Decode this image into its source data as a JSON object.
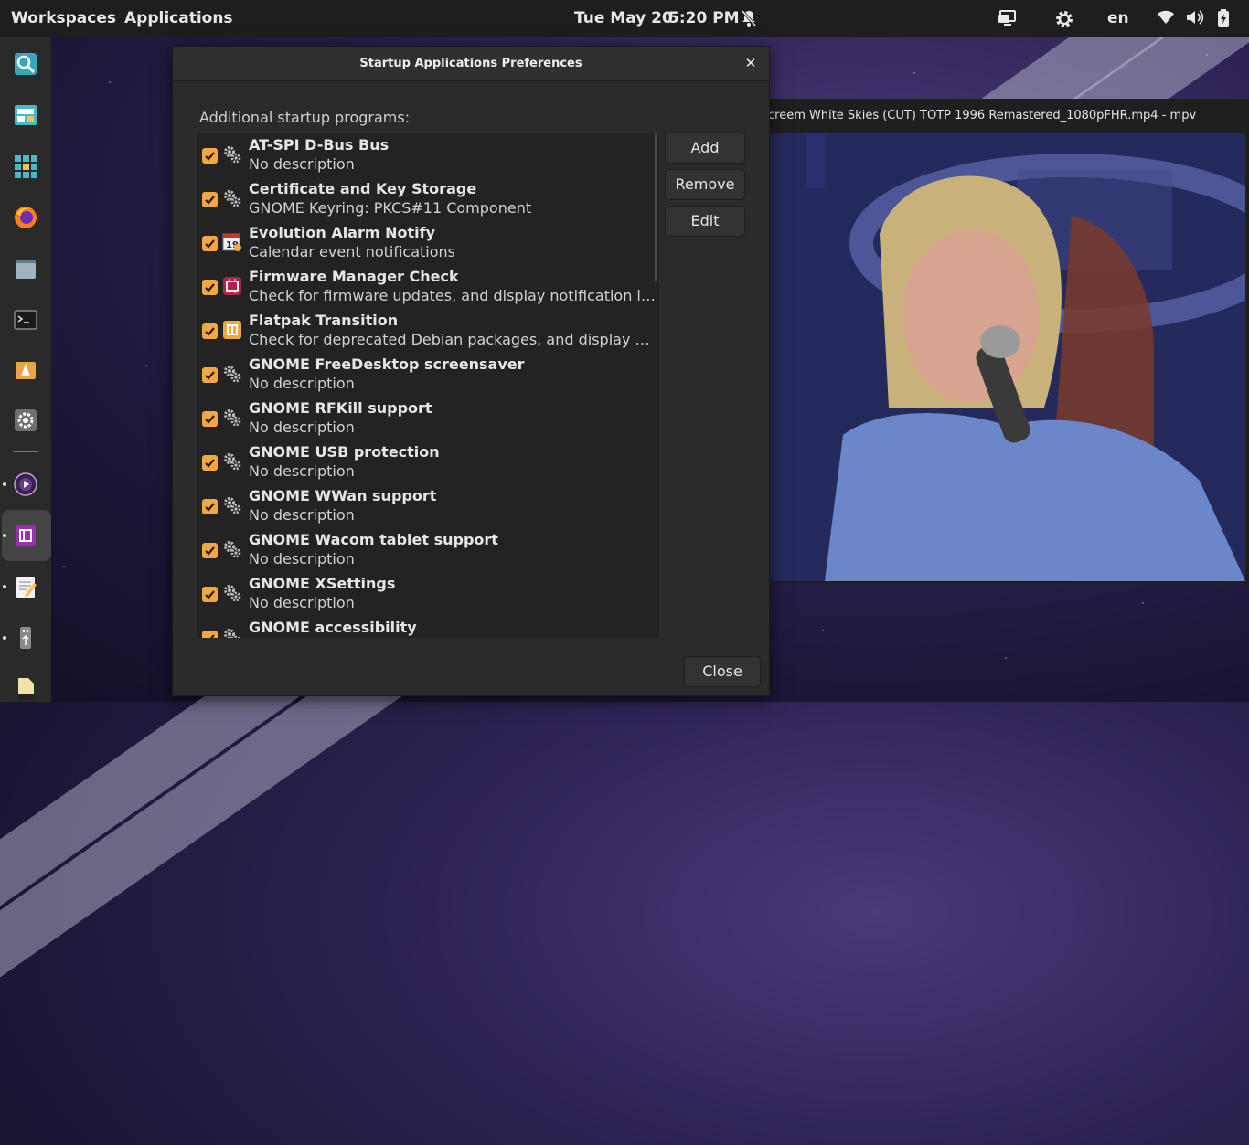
{
  "topbar": {
    "workspaces": "Workspaces",
    "applications": "Applications",
    "date": "Tue May 20",
    "time": "5:20 PM",
    "language": "en",
    "icons": [
      "bell-off-icon",
      "display-icon",
      "settings-icon",
      "wifi-icon",
      "volume-icon",
      "battery-icon"
    ]
  },
  "dock": {
    "items": [
      "search-icon",
      "app-store-icon",
      "app-grid-icon",
      "firefox-icon",
      "files-icon",
      "terminal-icon",
      "app-icon",
      "settings-icon",
      "media-player-icon",
      "app-icon",
      "text-editor-icon",
      "usb-icon",
      "document-icon"
    ]
  },
  "mpv": {
    "title": "creem White Skies (CUT) TOTP  1996 Remastered_1080pFHR.mp4 - mpv"
  },
  "dialog": {
    "title": "Startup Applications Preferences",
    "section_label": "Additional startup programs:",
    "buttons": {
      "add": "Add",
      "remove": "Remove",
      "edit": "Edit",
      "close": "Close"
    },
    "items": [
      {
        "name": "AT-SPI D-Bus Bus",
        "description": "No description",
        "checked": true,
        "icon": "gear-icon"
      },
      {
        "name": "Certificate and Key Storage",
        "description": "GNOME Keyring: PKCS#11 Component",
        "checked": true,
        "icon": "gear-icon"
      },
      {
        "name": "Evolution Alarm Notify",
        "description": "Calendar event notifications",
        "checked": true,
        "icon": "calendar-alarm-icon"
      },
      {
        "name": "Firmware Manager Check",
        "description": "Check for firmware updates, and display notification if fo...",
        "checked": true,
        "icon": "firmware-icon"
      },
      {
        "name": "Flatpak Transition",
        "description": "Check for deprecated Debian packages, and display notifi...",
        "checked": true,
        "icon": "package-icon"
      },
      {
        "name": "GNOME FreeDesktop screensaver",
        "description": "No description",
        "checked": true,
        "icon": "gear-icon"
      },
      {
        "name": "GNOME RFKill support",
        "description": "No description",
        "checked": true,
        "icon": "gear-icon"
      },
      {
        "name": "GNOME USB protection",
        "description": "No description",
        "checked": true,
        "icon": "gear-icon"
      },
      {
        "name": "GNOME WWan support",
        "description": "No description",
        "checked": true,
        "icon": "gear-icon"
      },
      {
        "name": "GNOME Wacom tablet support",
        "description": "No description",
        "checked": true,
        "icon": "gear-icon"
      },
      {
        "name": "GNOME XSettings",
        "description": "No description",
        "checked": true,
        "icon": "gear-icon"
      },
      {
        "name": "GNOME accessibility",
        "description": "",
        "checked": true,
        "icon": "gear-icon"
      }
    ]
  },
  "colors": {
    "accent": "#f4a741",
    "topbar_bg": "#1e1e1e",
    "dock_bg": "#2a2a2a",
    "dialog_bg": "#2b2b2b",
    "list_bg": "#232323"
  }
}
